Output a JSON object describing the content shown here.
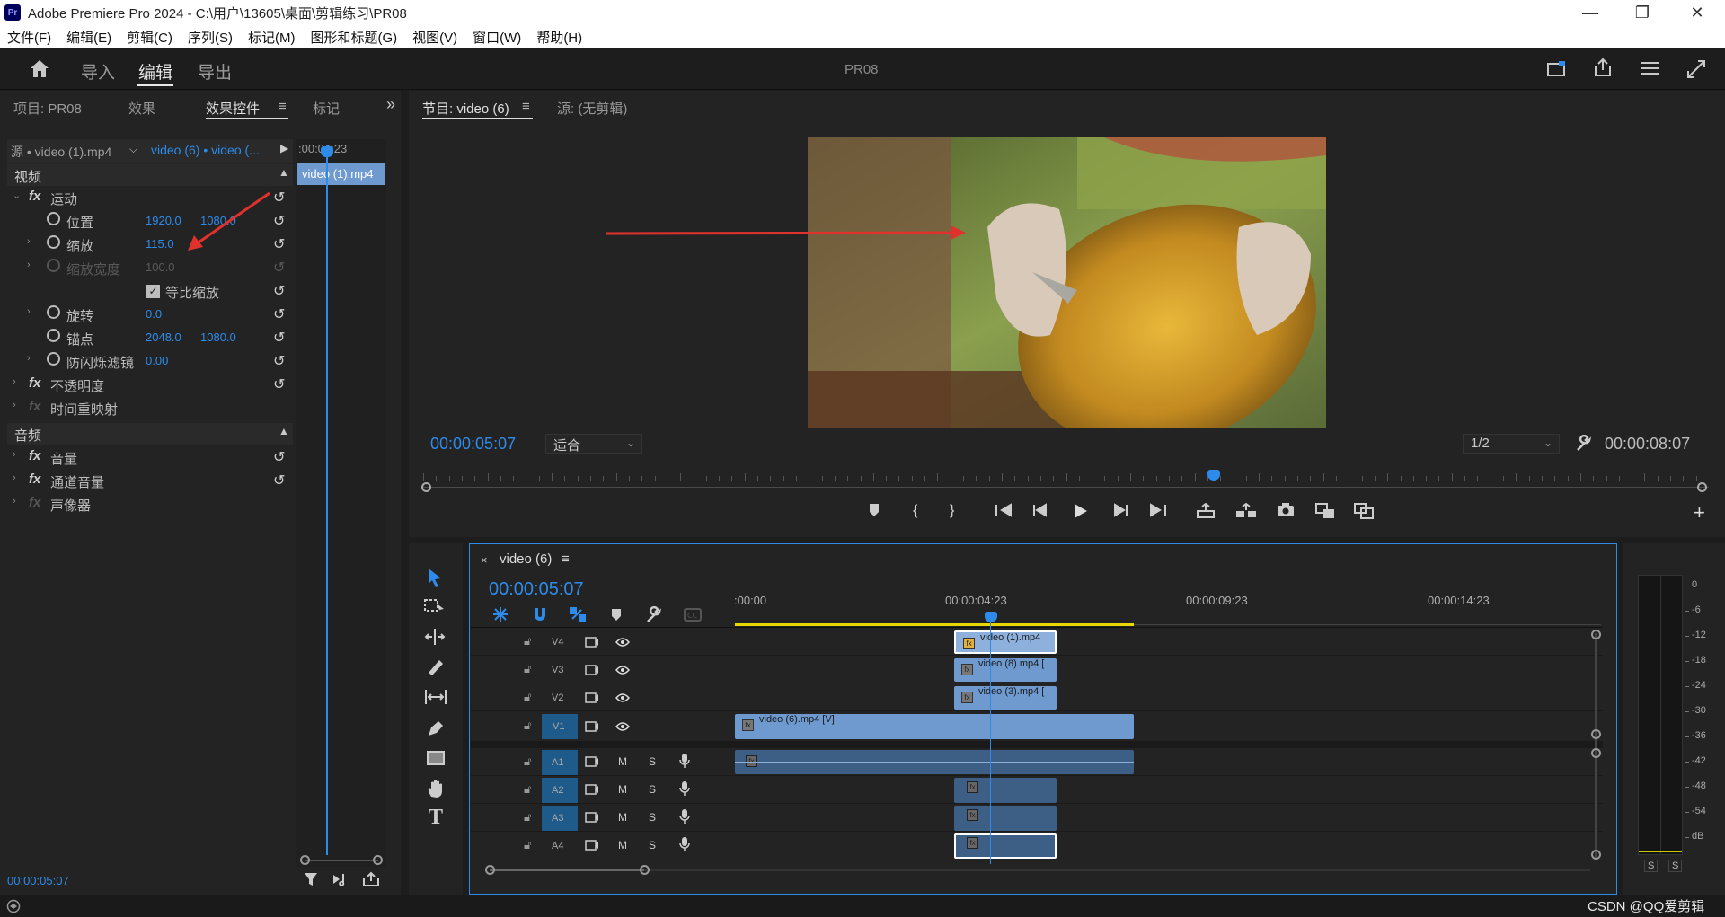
{
  "window": {
    "title": "Adobe Premiere Pro 2024 - C:\\用户\\13605\\桌面\\剪辑练习\\PR08",
    "logo": "Pr",
    "min": "—",
    "max": "❐",
    "close": "✕"
  },
  "menu": [
    "文件(F)",
    "编辑(E)",
    "剪辑(C)",
    "序列(S)",
    "标记(M)",
    "图形和标题(G)",
    "视图(V)",
    "窗口(W)",
    "帮助(H)"
  ],
  "workspace": {
    "tabs": [
      "导入",
      "编辑",
      "导出"
    ],
    "active": "编辑",
    "project_name": "PR08",
    "icons": [
      "home-icon",
      "quick-export-icon",
      "share-icon",
      "settings-icon",
      "fullscreen-icon"
    ]
  },
  "left_panel": {
    "tabs": [
      "项目: PR08",
      "效果",
      "效果控件",
      "标记"
    ],
    "active_tab": "效果控件",
    "source_label": "源 • video (1).mp4",
    "sequence_label": "video (6) • video (...",
    "mini_timecode": ":00:04:23",
    "mini_clip": "video (1).mp4",
    "section_video": "视频",
    "section_audio": "音频",
    "footer_timecode": "00:00:05:07",
    "rows": [
      {
        "name": "运动",
        "kind": "fx-group"
      },
      {
        "name": "位置",
        "v1": "1920.0",
        "v2": "1080.0"
      },
      {
        "name": "缩放",
        "v1": "115.0"
      },
      {
        "name": "缩放宽度",
        "v1": "100.0",
        "dim": true
      },
      {
        "name": "等比缩放",
        "kind": "checkbox",
        "checked": true
      },
      {
        "name": "旋转",
        "v1": "0.0"
      },
      {
        "name": "锚点",
        "v1": "2048.0",
        "v2": "1080.0"
      },
      {
        "name": "防闪烁滤镜",
        "v1": "0.00"
      },
      {
        "name": "不透明度",
        "kind": "fx-group"
      },
      {
        "name": "时间重映射",
        "kind": "fx-group-dim"
      }
    ],
    "audio_rows": [
      {
        "name": "音量",
        "kind": "fx-group"
      },
      {
        "name": "通道音量",
        "kind": "fx-group"
      },
      {
        "name": "声像器",
        "kind": "fx-group-dim"
      }
    ]
  },
  "program_monitor": {
    "tabs": [
      "节目: video (6)",
      "源: (无剪辑)"
    ],
    "timecode_current": "00:00:05:07",
    "zoom": "适合",
    "resolution": "1/2",
    "timecode_duration": "00:00:08:07",
    "playhead_fraction": 0.615
  },
  "timeline": {
    "sequence_name": "video (6)",
    "timecode": "00:00:05:07",
    "ruler": [
      ":00:00",
      "00:00:04:23",
      "00:00:09:23",
      "00:00:14:23"
    ],
    "video_tracks": [
      {
        "label": "V4",
        "clip": "video (1).mp4"
      },
      {
        "label": "V3",
        "clip": "video (8).mp4 ["
      },
      {
        "label": "V2",
        "clip": "video (3).mp4 ["
      },
      {
        "label": "V1",
        "clip": "video (6).mp4 [V]"
      }
    ],
    "audio_tracks": [
      "A1",
      "A2",
      "A3",
      "A4"
    ],
    "track_letters": {
      "mute": "M",
      "solo": "S"
    }
  },
  "meter": {
    "scale": [
      "0",
      "-6",
      "-12",
      "-18",
      "-24",
      "-30",
      "-36",
      "-42",
      "-48",
      "-54",
      "dB"
    ],
    "solo": [
      "S",
      "S"
    ]
  },
  "status": {
    "watermark": "CSDN @QQ爱剪辑"
  },
  "colors": {
    "accent": "#2d8ceb",
    "clip": "#6f9ad0",
    "annotation_arrow": "#e0322d",
    "work_area": "#e8d800"
  }
}
